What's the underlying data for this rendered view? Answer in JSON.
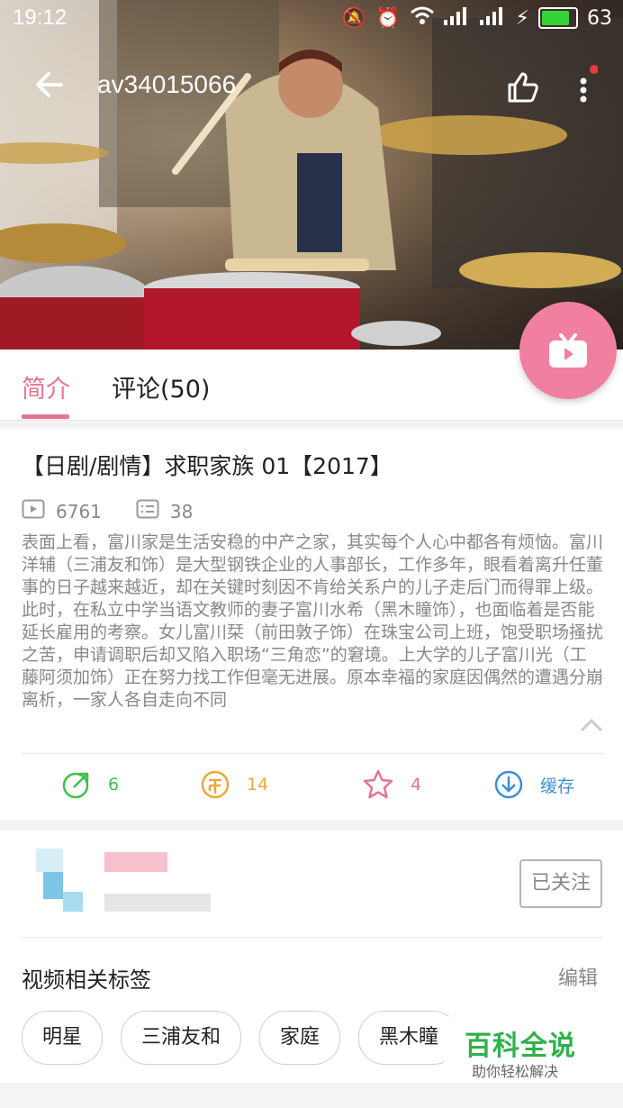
{
  "status_bar": {
    "time": "19:12",
    "battery": "63"
  },
  "topbar": {
    "title": "av34015066"
  },
  "tabs": [
    {
      "label": "简介"
    },
    {
      "label": "评论(50)"
    }
  ],
  "video_info": {
    "title": "【日剧/剧情】求职家族 01【2017】",
    "play_count": "6761",
    "danmaku_count": "38",
    "description": "表面上看，富川家是生活安稳的中产之家，其实每个人心中都各有烦恼。富川洋辅（三浦友和饰）是大型钢铁企业的人事部长，工作多年，眼看着离升任董事的日子越来越近，却在关键时刻因不肯给关系户的儿子走后门而得罪上级。此时，在私立中学当语文教师的妻子富川水希（黑木瞳饰），也面临着是否能延长雇用的考察。女儿富川栞（前田敦子饰）在珠宝公司上班，饱受职场搔扰之苦，申请调职后却又陷入职场“三角恋”的窘境。上大学的儿子富川光（工藤阿须加饰）正在努力找工作但毫无进展。原本幸福的家庭因偶然的遭遇分崩离析，一家人各自走向不同"
  },
  "actions": {
    "share_count": "6",
    "coin_count": "14",
    "fav_count": "4",
    "cache_label": "缓存"
  },
  "uploader": {
    "follow_label": "已关注"
  },
  "tags_section": {
    "title": "视频相关标签",
    "edit_label": "编辑",
    "tags": [
      "明星",
      "三浦友和",
      "家庭",
      "黑木瞳"
    ]
  },
  "watermark": {
    "title": "百科全说",
    "subtitle": "助你轻松解决"
  },
  "colors": {
    "accent_pink": "#e8738f",
    "share_green": "#3fc04a",
    "coin_yellow": "#e8a93a",
    "fav_pink": "#e8738f",
    "cache_blue": "#3c8fd6"
  }
}
